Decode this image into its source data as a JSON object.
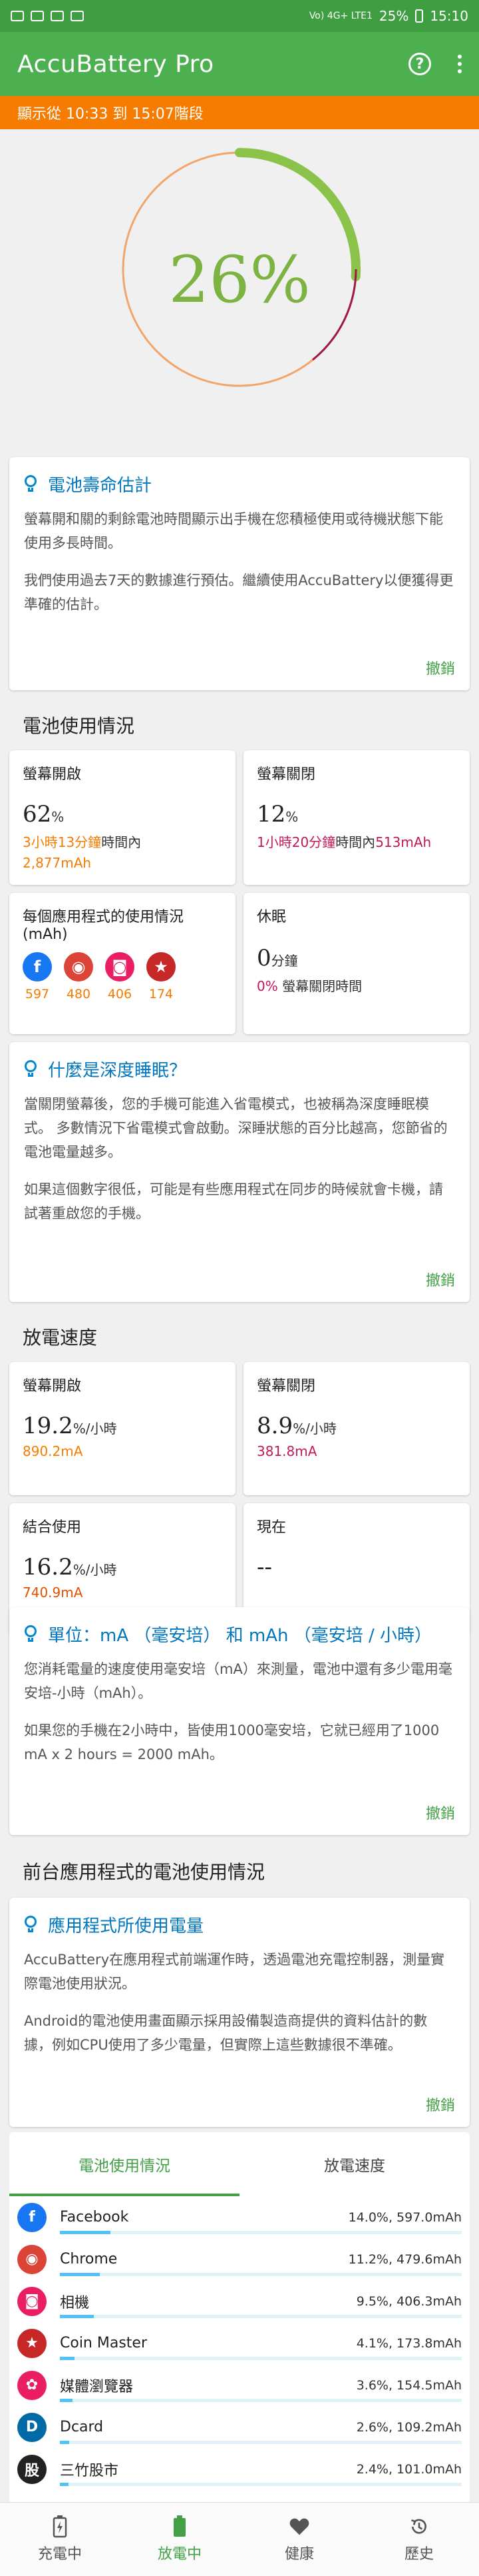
{
  "status_bar": {
    "signal": "Vo) 4G+ LTE1",
    "battery": "25%",
    "time": "15:10"
  },
  "app": {
    "title": "AccuBattery Pro"
  },
  "banner": {
    "text": "顯示從 10:33 到 15:07階段"
  },
  "gauge": {
    "percent": "26%",
    "level": 0.26
  },
  "life_card": {
    "title": "電池壽命估計",
    "p1": "螢幕開和關的剩餘電池時間顯示出手機在您積極使用或待機狀態下能使用多長時間。",
    "p2": "我們使用過去7天的數據進行預估。繼續使用AccuBattery以便獲得更準確的估計。",
    "dismiss": "撤銷"
  },
  "usage": {
    "title": "電池使用情況",
    "screen_on": {
      "label": "螢幕開啟",
      "pct": "62",
      "unit": "%",
      "time": "3小時13分鐘",
      "time_suffix": "時間內",
      "mah": "2,877mAh"
    },
    "screen_off": {
      "label": "螢幕關閉",
      "pct": "12",
      "unit": "%",
      "time": "1小時20分鐘",
      "time_suffix": "時間內",
      "mah": "513mAh"
    },
    "per_app": {
      "label": "每個應用程式的使用情況 (mAh)",
      "apps": [
        {
          "icon": "facebook-icon",
          "value": "597",
          "color": "#1877f2",
          "glyph": "f"
        },
        {
          "icon": "chrome-icon",
          "value": "480",
          "color": "#db4437",
          "glyph": "◉"
        },
        {
          "icon": "camera-icon",
          "value": "406",
          "color": "#e91e63",
          "glyph": "◙"
        },
        {
          "icon": "coin-master-icon",
          "value": "174",
          "color": "#c62828",
          "glyph": "★"
        }
      ]
    },
    "sleep": {
      "label": "休眠",
      "value": "0",
      "unit": "分鐘",
      "pct": "0%",
      "desc": "螢幕關閉時間"
    }
  },
  "deep_sleep_card": {
    "title": "什麼是深度睡眠？",
    "p1": "當關閉螢幕後，您的手機可能進入省電模式，也被稱為深度睡眠模式。 多數情況下省電模式會啟動。深睡狀態的百分比越高，您節省的電池電量越多。",
    "p2": "如果這個數字很低，可能是有些應用程式在同步的時候就會卡機，請試著重啟您的手機。",
    "dismiss": "撤銷"
  },
  "discharge": {
    "title": "放電速度",
    "screen_on": {
      "label": "螢幕開啟",
      "value": "19.2",
      "unit": "%/小時",
      "mah": "890.2mA"
    },
    "screen_off": {
      "label": "螢幕關閉",
      "value": "8.9",
      "unit": "%/小時",
      "mah": "381.8mA"
    },
    "combined": {
      "label": "結合使用",
      "value": "16.2",
      "unit": "%/小時",
      "mah": "740.9mA"
    },
    "current": {
      "label": "現在",
      "value": "--"
    }
  },
  "unit_card": {
    "title": "單位：mA （毫安培） 和 mAh （毫安培 / 小時）",
    "p1": "您消耗電量的速度使用毫安培（mA）來測量，電池中還有多少電用毫安培-小時（mAh）。",
    "p2": "如果您的手機在2小時中，皆使用1000毫安培，它就已經用了1000 mA x 2 hours = 2000 mAh。",
    "dismiss": "撤銷"
  },
  "foreground": {
    "title": "前台應用程式的電池使用情況",
    "card_title": "應用程式所使用電量",
    "p1": "AccuBattery在應用程式前端運作時，透過電池充電控制器，測量實際電池使用狀況。",
    "p2": "Android的電池使用畫面顯示採用設備製造商提供的資料估計的數據，例如CPU使用了多少電量，但實際上這些數據很不準確。",
    "dismiss": "撤銷"
  },
  "tabs": [
    "電池使用情況",
    "放電速度"
  ],
  "app_list": [
    {
      "name": "Facebook",
      "value": "14.0%, 597.0mAh",
      "share": 0.14,
      "color": "#1877f2",
      "glyph": "f",
      "icon": "facebook-icon"
    },
    {
      "name": "Chrome",
      "value": "11.2%, 479.6mAh",
      "share": 0.112,
      "color": "#db4437",
      "glyph": "◉",
      "icon": "chrome-icon"
    },
    {
      "name": "相機",
      "value": "9.5%, 406.3mAh",
      "share": 0.095,
      "color": "#e91e63",
      "glyph": "◙",
      "icon": "camera-icon"
    },
    {
      "name": "Coin Master",
      "value": "4.1%, 173.8mAh",
      "share": 0.041,
      "color": "#c62828",
      "glyph": "★",
      "icon": "coin-master-icon"
    },
    {
      "name": "媒體瀏覽器",
      "value": "3.6%, 154.5mAh",
      "share": 0.036,
      "color": "#e91e63",
      "glyph": "✿",
      "icon": "media-browser-icon"
    },
    {
      "name": "Dcard",
      "value": "2.6%, 109.2mAh",
      "share": 0.026,
      "color": "#006aa6",
      "glyph": "D",
      "icon": "dcard-icon"
    },
    {
      "name": "三竹股市",
      "value": "2.4%, 101.0mAh",
      "share": 0.024,
      "color": "#222222",
      "glyph": "股",
      "icon": "stock-app-icon"
    }
  ],
  "bottom_nav": [
    {
      "label": "充電中",
      "icon": "charging-icon"
    },
    {
      "label": "放電中",
      "icon": "discharging-icon"
    },
    {
      "label": "健康",
      "icon": "heart-icon"
    },
    {
      "label": "歷史",
      "icon": "history-icon"
    }
  ]
}
